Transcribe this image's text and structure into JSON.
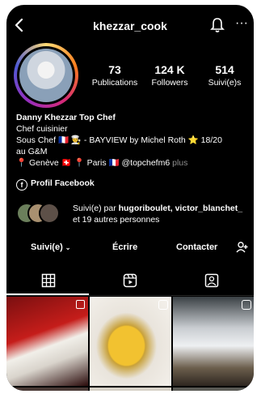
{
  "header": {
    "username": "khezzar_cook"
  },
  "stats": [
    {
      "value": "73",
      "label": "Publications"
    },
    {
      "value": "124 K",
      "label": "Followers"
    },
    {
      "value": "514",
      "label": "Suivi(e)s"
    }
  ],
  "bio": {
    "name": "Danny Khezzar Top Chef",
    "line1": "Chef cuisinier",
    "line2": "Sous Chef 🇫🇷 👨‍🍳 - BAYVIEW by Michel Roth ⭐ 18/20",
    "line3": "au G&M",
    "line4": "📍 Genève 🇨🇭 📍 Paris 🇫🇷 @topchefm6",
    "more": "plus"
  },
  "facebook": {
    "label": "Profil Facebook"
  },
  "followed_by": {
    "prefix": "Suivi(e) par",
    "names": "hugoriboulet, victor_blanchet_",
    "suffix": "et 19 autres personnes"
  },
  "actions": {
    "following": "Suivi(e)",
    "message": "Écrire",
    "contact": "Contacter"
  },
  "icons": {
    "back": "chevron-left-icon",
    "bell": "bell-icon",
    "more": "more-icon",
    "grid": "grid-icon",
    "reels": "reels-icon",
    "tagged": "tagged-icon",
    "add_user": "add-user-icon"
  }
}
